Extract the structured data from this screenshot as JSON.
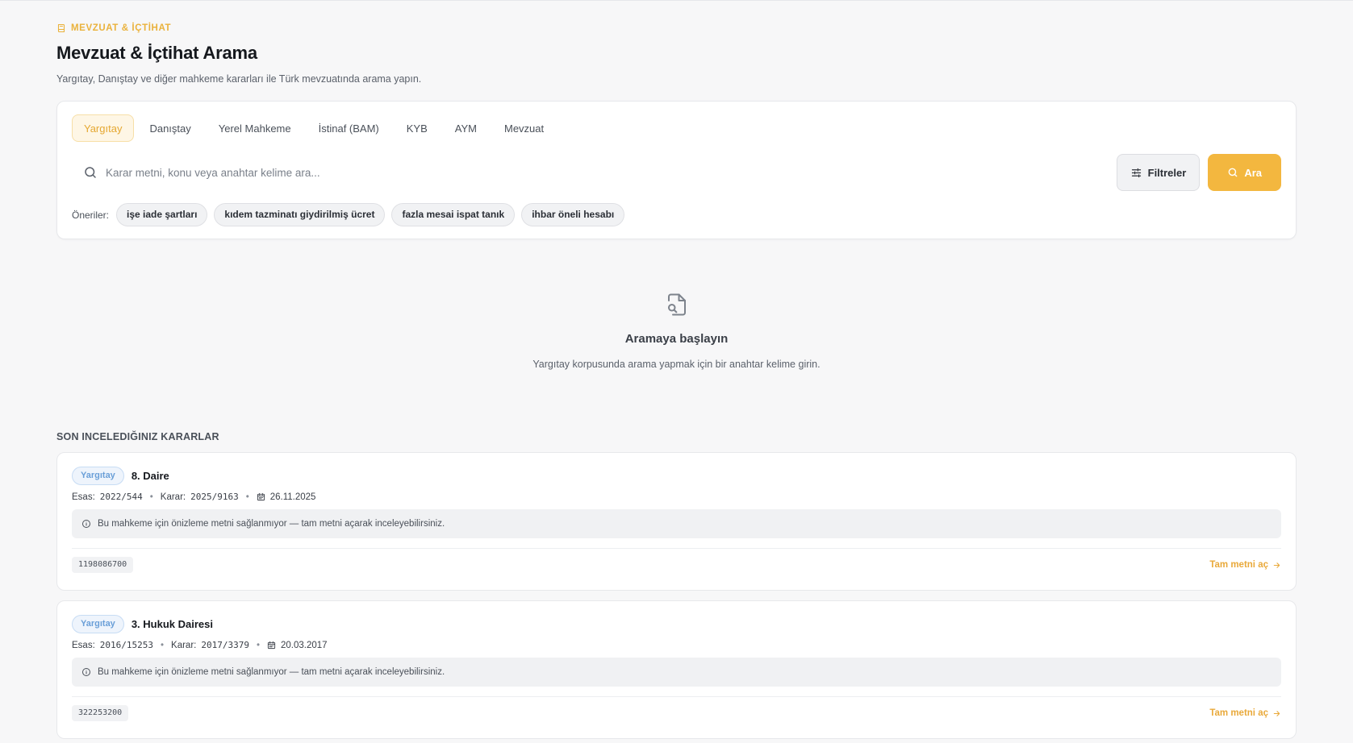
{
  "header": {
    "eyebrow": "MEVZUAT & İÇTİHAT",
    "title": "Mevzuat & İçtihat Arama",
    "subtitle": "Yargıtay, Danıştay ve diğer mahkeme kararları ile Türk mevzuatında arama yapın."
  },
  "tabs": [
    {
      "label": "Yargıtay",
      "active": true
    },
    {
      "label": "Danıştay",
      "active": false
    },
    {
      "label": "Yerel Mahkeme",
      "active": false
    },
    {
      "label": "İstinaf (BAM)",
      "active": false
    },
    {
      "label": "KYB",
      "active": false
    },
    {
      "label": "AYM",
      "active": false
    },
    {
      "label": "Mevzuat",
      "active": false
    }
  ],
  "search": {
    "placeholder": "Karar metni, konu veya anahtar kelime ara...",
    "value": "",
    "filter_label": "Filtreler",
    "search_label": "Ara"
  },
  "suggestions": {
    "label": "Öneriler:",
    "items": [
      "işe iade şartları",
      "kıdem tazminatı giydirilmiş ücret",
      "fazla mesai ispat tanık",
      "ihbar öneli hesabı"
    ]
  },
  "empty_state": {
    "icon": "file-search-icon",
    "title": "Aramaya başlayın",
    "text": "Yargıtay korpusunda arama yapmak için bir anahtar kelime girin."
  },
  "recent": {
    "title": "SON INCELEDIĞINIZ KARARLAR",
    "cases": [
      {
        "badge": "Yargıtay",
        "title": "8. Daire",
        "esas_label": "Esas:",
        "esas": "2022/544",
        "karar_label": "Karar:",
        "karar": "2025/9163",
        "date": "26.11.2025",
        "notice": "Bu mahkeme için önizleme metni sağlanmıyor — tam metni açarak inceleyebilirsiniz.",
        "id": "1198086700",
        "link": "Tam metni aç"
      },
      {
        "badge": "Yargıtay",
        "title": "3. Hukuk Dairesi",
        "esas_label": "Esas:",
        "esas": "2016/15253",
        "karar_label": "Karar:",
        "karar": "2017/3379",
        "date": "20.03.2017",
        "notice": "Bu mahkeme için önizleme metni sağlanmıyor — tam metni açarak inceleyebilirsiniz.",
        "id": "322253200",
        "link": "Tam metni aç"
      }
    ]
  },
  "colors": {
    "accent": "#f3b73f",
    "badge_blue": "#6a9fd8",
    "background": "#f7f7f8"
  }
}
